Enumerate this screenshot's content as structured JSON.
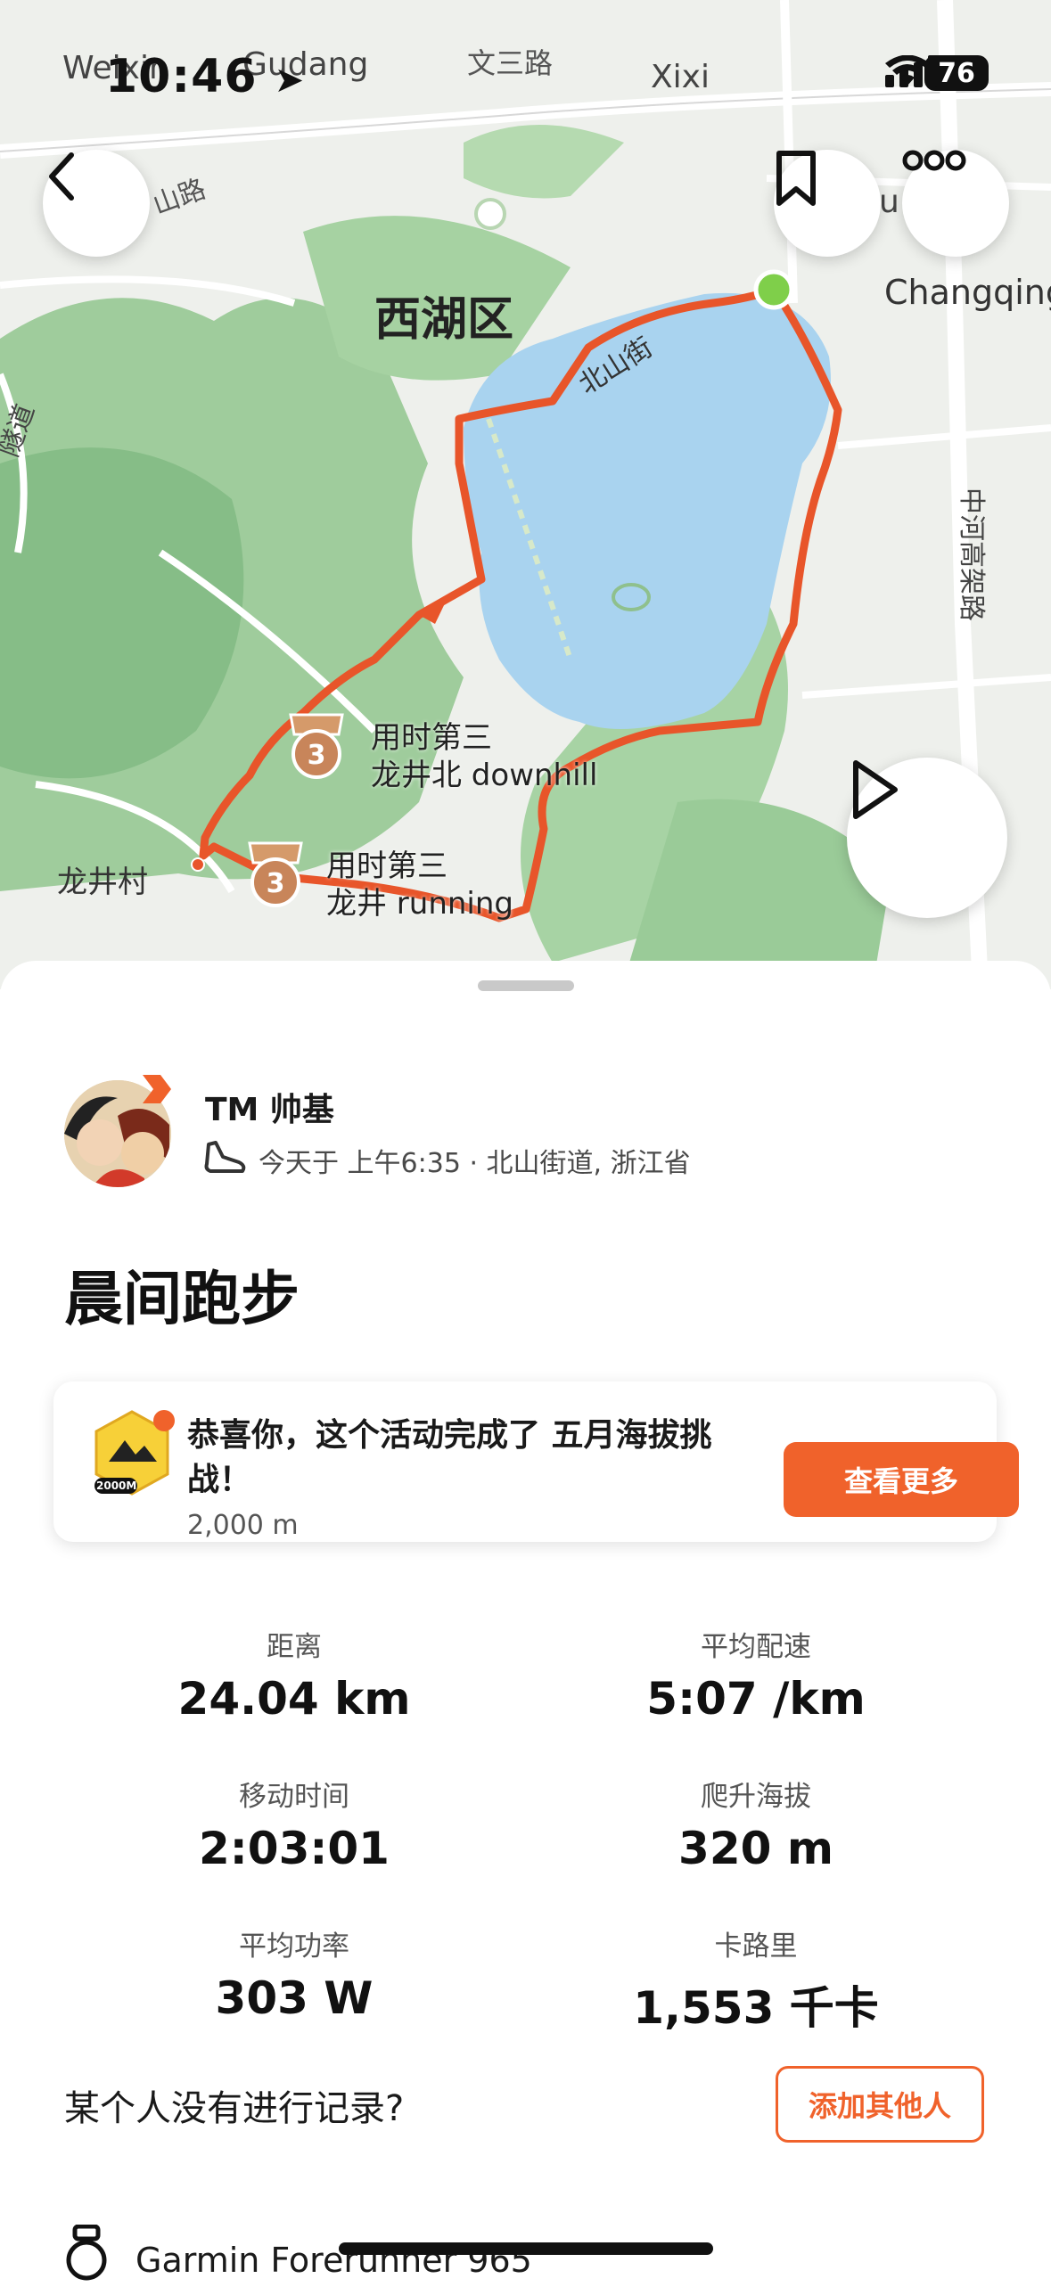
{
  "status_bar": {
    "time": "10:46",
    "battery": "76"
  },
  "map": {
    "labels": {
      "weixin": "Weixin",
      "gudang": "Gudang",
      "wensan_road": "文三路",
      "xixi": "Xixi",
      "beishan_road_top": "山路",
      "shui": "u",
      "changqing": "Changqing",
      "xihu_district": "西湖区",
      "beishan_street": "北山街",
      "tunnel": "隧道",
      "zhonghe_viaduct": "中河高架路",
      "longjing_village": "龙井村"
    },
    "segments": [
      {
        "rank": "3",
        "line1": "用时第三",
        "line2": "龙井北 downhill"
      },
      {
        "rank": "3",
        "line1": "用时第三",
        "line2": "龙井 running"
      }
    ]
  },
  "athlete": {
    "name": "TM 帅基",
    "meta": "今天于 上午6:35 · 北山街道, 浙江省"
  },
  "activity": {
    "title": "晨间跑步"
  },
  "challenge": {
    "message": "恭喜你，这个活动完成了 五月海拔挑战！",
    "value": "2,000 m",
    "badge_text": "2000M",
    "button": "查看更多"
  },
  "stats": [
    {
      "label": "距离",
      "value": "24.04 km"
    },
    {
      "label": "平均配速",
      "value": "5:07 /km"
    },
    {
      "label": "移动时间",
      "value": "2:03:01"
    },
    {
      "label": "爬升海拔",
      "value": "320 m"
    },
    {
      "label": "平均功率",
      "value": "303 W"
    },
    {
      "label": "卡路里",
      "value": "1,553 千卡"
    }
  ],
  "record_prompt": "某个人没有进行记录?",
  "add_others": "添加其他人",
  "device": "Garmin Forerunner 965",
  "colors": {
    "accent": "#f0622b",
    "route": "#e8552a",
    "lake": "#a9d3ef",
    "park": "#8cc48e"
  }
}
